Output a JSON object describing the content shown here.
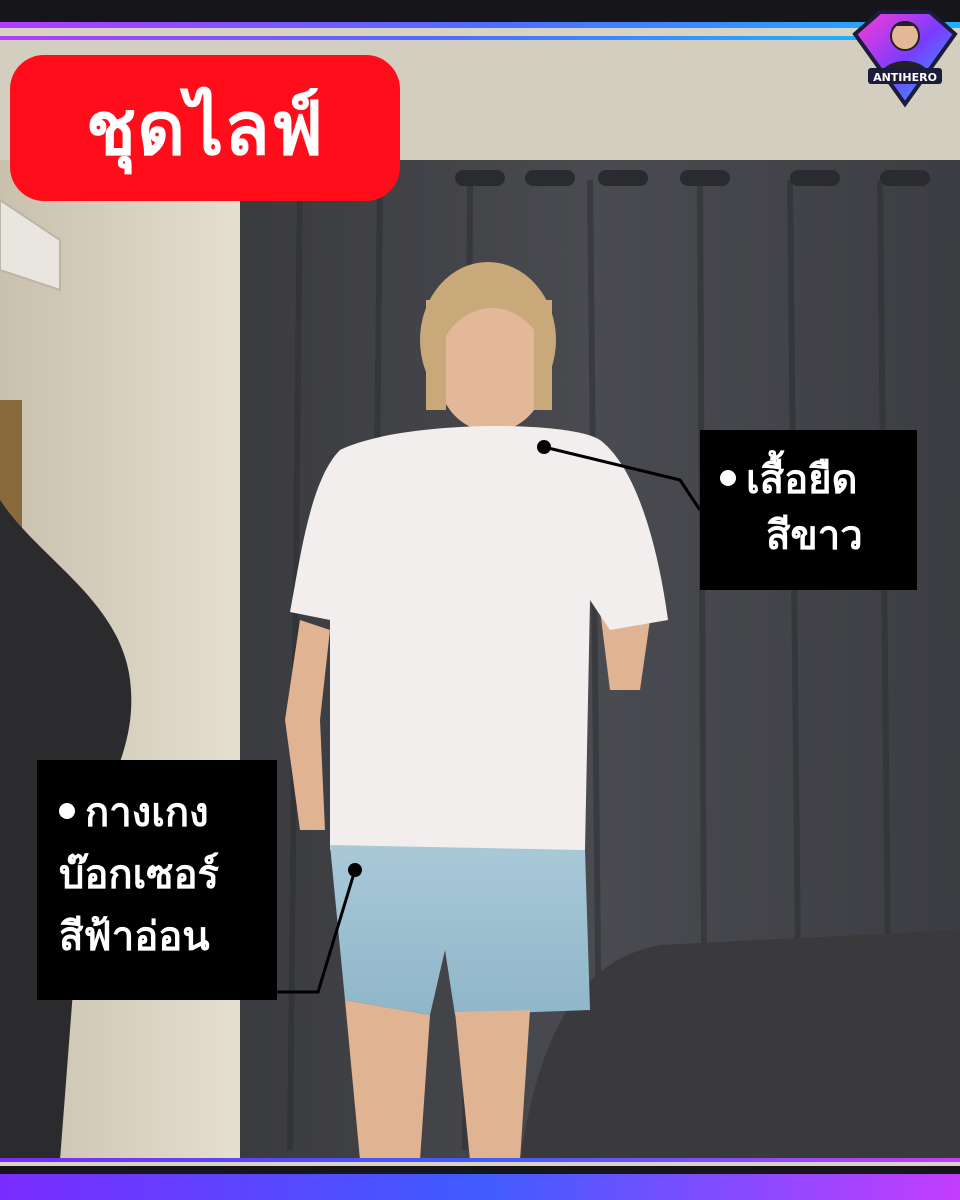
{
  "title": "ชุดไลฟ์",
  "logo_text": "ANTIHERO",
  "annotations": {
    "shirt": {
      "line1": "เสื้อยืด",
      "line2": "สีขาว"
    },
    "shorts": {
      "line1": "กางเกง",
      "line2": "บ๊อกเซอร์",
      "line3": "สีฟ้าอ่อน"
    }
  },
  "colors": {
    "title_bg": "#ff0d1a",
    "label_bg": "#000000",
    "frame_top": "#7a3cff",
    "frame_bottom": "#c23cff"
  }
}
